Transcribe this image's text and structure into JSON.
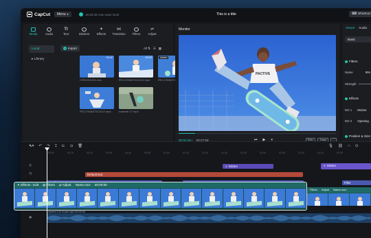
{
  "app": {
    "logo": "CapCut",
    "menu_label": "Menu",
    "autosave": "16:30:28 Auto save local",
    "title": "This is a title",
    "shortcut_label": "Shortcut"
  },
  "toolbar_tabs": [
    {
      "label": "Media",
      "icon": "media-icon"
    },
    {
      "label": "Audio",
      "icon": "audio-icon"
    },
    {
      "label": "Text",
      "icon": "text-icon"
    },
    {
      "label": "Stickers",
      "icon": "stickers-icon"
    },
    {
      "label": "Effects",
      "icon": "effects-icon"
    },
    {
      "label": "Transition",
      "icon": "transition-icon"
    },
    {
      "label": "Filters",
      "icon": "filters-icon"
    },
    {
      "label": "Adjust",
      "icon": "adjust-icon"
    }
  ],
  "media": {
    "nav": [
      "Local",
      "Library"
    ],
    "import_label": "Import",
    "view_all": "All",
    "items": [
      {
        "name": "CR51201234.mov",
        "duration": "00:02",
        "badge": ""
      },
      {
        "name": "RE12783637412412.mp4",
        "duration": "00:02",
        "badge": ""
      },
      {
        "name": "RE12783637412412.mp4",
        "duration": "00:02",
        "badge": "Added"
      },
      {
        "name": "RE12783637412412.mp4",
        "duration": "",
        "badge": ""
      },
      {
        "name": "material 17.mp4",
        "duration": "",
        "badge": ""
      }
    ]
  },
  "monitor": {
    "title": "Monitor",
    "current_time": "00:02:45",
    "total_time": "00:27:58",
    "ratio_labels": [
      "Ratio",
      "Adapt"
    ]
  },
  "inspector": {
    "tabs": [
      "Visual",
      "Audio"
    ],
    "basic_label": "Basic",
    "filters_section": "Filters",
    "name_label": "Name",
    "name_value": "90s",
    "strength_label": "Strength",
    "effects_section": "Effects",
    "effect_rows": [
      {
        "label": "NO 1",
        "value": "Motion"
      },
      {
        "label": "NO 2",
        "value": "Opening"
      }
    ],
    "position_label": "Position & Size"
  },
  "timeline": {
    "ruler": [
      "00:00",
      "00:10",
      "00:20",
      "00:30",
      "00:40",
      "00:50",
      "01:00",
      "01:10",
      "01:20",
      "01:30",
      "01:40",
      "01:50",
      "02:00",
      "02:10",
      "02:20",
      "02:30",
      "02:40"
    ],
    "clips": {
      "sticker1": "Sticker",
      "sticker2": "Sticker",
      "text": "Default text",
      "filter1": "Filter",
      "filter2": "Final",
      "filter3": "Filter"
    },
    "main_header": [
      "Effects - Edit",
      "Filters",
      "Adjust",
      "Name.mov",
      "00:00:00"
    ],
    "ext_header": [
      "Filters",
      "Adjust",
      "Name.mov",
      "00:00:00"
    ],
    "audio_label": "Speed 2.0x   Audio.mp3   00:00:00"
  }
}
